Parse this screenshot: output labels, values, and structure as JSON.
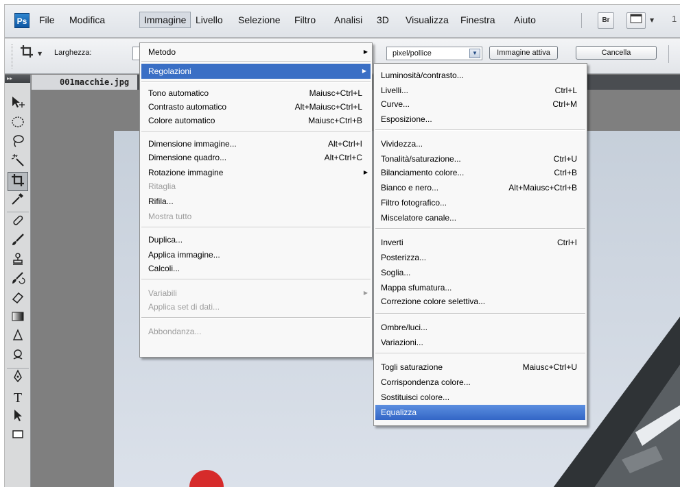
{
  "app_logo": "Ps",
  "menubar": {
    "items": [
      "File",
      "Modifica",
      "Immagine",
      "Livello",
      "Selezione",
      "Filtro",
      "Analisi",
      "3D",
      "Visualizza",
      "Finestra",
      "Aiuto"
    ],
    "active": "Immagine",
    "bridge_button": "Br",
    "cut_text": "1"
  },
  "options_bar": {
    "width_label": "Larghezza:",
    "units_select": "pixel/pollice",
    "front_image_button": "Immagine attiva",
    "clear_button": "Cancella"
  },
  "tools_panel": {
    "header": "▸▸",
    "tools": [
      "move-icon",
      "elliptical-marquee-icon",
      "lasso-icon",
      "magic-wand-icon",
      "crop-icon",
      "eyedropper-icon",
      "healing-brush-icon",
      "brush-icon",
      "clone-stamp-icon",
      "history-brush-icon",
      "eraser-icon",
      "gradient-icon",
      "blur-icon",
      "dodge-icon",
      "pen-icon",
      "type-icon",
      "path-selection-icon",
      "rectangle-shape-icon"
    ],
    "selected_tool": "crop-icon"
  },
  "document": {
    "tab_title": "001macchie.jpg"
  },
  "immagine_menu": {
    "items": [
      {
        "label": "Metodo",
        "shortcut": "",
        "submenu": true,
        "disabled": false
      },
      {
        "label": "Regolazioni",
        "shortcut": "",
        "submenu": true,
        "disabled": false,
        "highlighted": true
      },
      {
        "label": "Tono automatico",
        "shortcut": "Maiusc+Ctrl+L",
        "submenu": false,
        "disabled": false
      },
      {
        "label": "Contrasto automatico",
        "shortcut": "Alt+Maiusc+Ctrl+L",
        "submenu": false,
        "disabled": false
      },
      {
        "label": "Colore automatico",
        "shortcut": "Maiusc+Ctrl+B",
        "submenu": false,
        "disabled": false
      },
      {
        "label": "Dimensione immagine...",
        "shortcut": "Alt+Ctrl+I",
        "submenu": false,
        "disabled": false
      },
      {
        "label": "Dimensione quadro...",
        "shortcut": "Alt+Ctrl+C",
        "submenu": false,
        "disabled": false
      },
      {
        "label": "Rotazione immagine",
        "shortcut": "",
        "submenu": true,
        "disabled": false
      },
      {
        "label": "Ritaglia",
        "shortcut": "",
        "submenu": false,
        "disabled": true
      },
      {
        "label": "Rifila...",
        "shortcut": "",
        "submenu": false,
        "disabled": false
      },
      {
        "label": "Mostra tutto",
        "shortcut": "",
        "submenu": false,
        "disabled": true
      },
      {
        "label": "Duplica...",
        "shortcut": "",
        "submenu": false,
        "disabled": false
      },
      {
        "label": "Applica immagine...",
        "shortcut": "",
        "submenu": false,
        "disabled": false
      },
      {
        "label": "Calcoli...",
        "shortcut": "",
        "submenu": false,
        "disabled": false
      },
      {
        "label": "Variabili",
        "shortcut": "",
        "submenu": true,
        "disabled": true
      },
      {
        "label": "Applica set di dati...",
        "shortcut": "",
        "submenu": false,
        "disabled": true
      },
      {
        "label": "Abbondanza...",
        "shortcut": "",
        "submenu": false,
        "disabled": true
      }
    ]
  },
  "regolazioni_menu": {
    "items": [
      {
        "label": "Luminosità/contrasto...",
        "shortcut": ""
      },
      {
        "label": "Livelli...",
        "shortcut": "Ctrl+L"
      },
      {
        "label": "Curve...",
        "shortcut": "Ctrl+M"
      },
      {
        "label": "Esposizione...",
        "shortcut": ""
      },
      {
        "label": "Vividezza...",
        "shortcut": ""
      },
      {
        "label": "Tonalità/saturazione...",
        "shortcut": "Ctrl+U"
      },
      {
        "label": "Bilanciamento colore...",
        "shortcut": "Ctrl+B"
      },
      {
        "label": "Bianco e nero...",
        "shortcut": "Alt+Maiusc+Ctrl+B"
      },
      {
        "label": "Filtro fotografico...",
        "shortcut": ""
      },
      {
        "label": "Miscelatore canale...",
        "shortcut": ""
      },
      {
        "label": "Inverti",
        "shortcut": "Ctrl+I"
      },
      {
        "label": "Posterizza...",
        "shortcut": ""
      },
      {
        "label": "Soglia...",
        "shortcut": ""
      },
      {
        "label": "Mappa sfumatura...",
        "shortcut": ""
      },
      {
        "label": "Correzione colore selettiva...",
        "shortcut": ""
      },
      {
        "label": "Ombre/luci...",
        "shortcut": ""
      },
      {
        "label": "Variazioni...",
        "shortcut": ""
      },
      {
        "label": "Togli saturazione",
        "shortcut": "Maiusc+Ctrl+U"
      },
      {
        "label": "Corrispondenza colore...",
        "shortcut": ""
      },
      {
        "label": "Sostituisci colore...",
        "shortcut": ""
      },
      {
        "label": "Equalizza",
        "shortcut": "",
        "highlighted": true
      }
    ]
  }
}
